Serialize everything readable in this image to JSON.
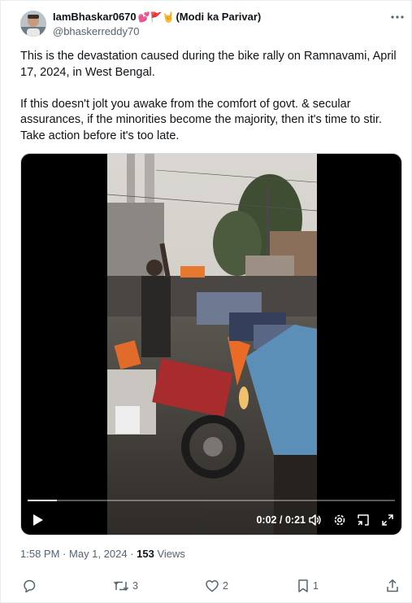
{
  "author": {
    "display_name": "IamBhaskar0670",
    "emoji_suffix": "💕🚩🤘",
    "affiliation": "(Modi ka Parivar)",
    "handle": "@bhaskerreddy70"
  },
  "tweet": {
    "paragraph_1": "This is the devastation caused during the bike rally on Ramnavami, April 17, 2024, in West Bengal.",
    "paragraph_2": "If this doesn't jolt you awake from the comfort of govt. & secular assurances, if the minorities become the majority, then it's time to stir. Take action before it's too late."
  },
  "video": {
    "current_time": "0:02",
    "separator": "/",
    "duration": "0:21",
    "progress_fraction": 0.08
  },
  "meta": {
    "time": "1:58 PM",
    "dot": "·",
    "date": "May 1, 2024",
    "views_count": "153",
    "views_label": "Views"
  },
  "actions": {
    "reply_count": "",
    "retweet_count": "3",
    "like_count": "2",
    "bookmark_count": "1"
  },
  "colors": {
    "text": "#0f1419",
    "muted": "#536471",
    "border": "#cfd9de"
  },
  "icons": [
    "more-icon",
    "play-icon",
    "volume-icon",
    "settings-icon",
    "pip-icon",
    "fullscreen-icon",
    "reply-icon",
    "retweet-icon",
    "like-icon",
    "bookmark-icon",
    "share-icon"
  ]
}
